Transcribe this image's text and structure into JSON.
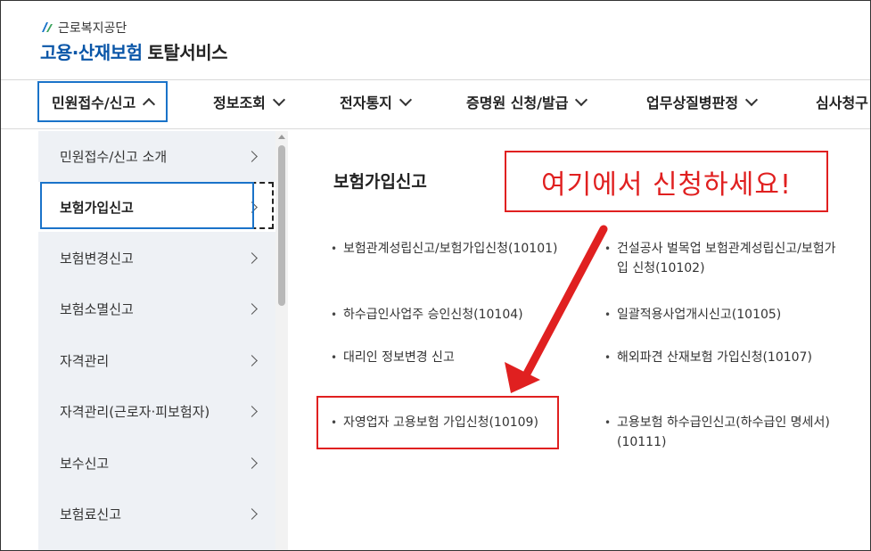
{
  "header": {
    "org_name": "근로복지공단",
    "service_brand": "고용·산재보험",
    "service_tail": "토탈서비스"
  },
  "nav": {
    "items": [
      {
        "label": "민원접수/신고",
        "expanded": true
      },
      {
        "label": "정보조회"
      },
      {
        "label": "전자통지"
      },
      {
        "label": "증명원 신청/발급"
      },
      {
        "label": "업무상질병판정"
      },
      {
        "label": "심사청구"
      }
    ]
  },
  "sidebar": {
    "items": [
      {
        "label": "민원접수/신고 소개"
      },
      {
        "label": "보험가입신고",
        "selected": true
      },
      {
        "label": "보험변경신고"
      },
      {
        "label": "보험소멸신고"
      },
      {
        "label": "자격관리"
      },
      {
        "label": "자격관리(근로자·피보험자)"
      },
      {
        "label": "보수신고"
      },
      {
        "label": "보험료신고"
      }
    ]
  },
  "main": {
    "title": "보험가입신고",
    "links": [
      {
        "line1": "보험관계성립신고/보험가입신청(10101)",
        "line2": ""
      },
      {
        "line1": "건설공사 벌목업 보험관계성립신고/보험가",
        "line2": "입 신청(10102)"
      },
      {
        "line1": "하수급인사업주 승인신청(10104)",
        "line2": ""
      },
      {
        "line1": "일괄적용사업개시신고(10105)",
        "line2": ""
      },
      {
        "line1": "대리인 정보변경 신고",
        "line2": ""
      },
      {
        "line1": "해외파견 산재보험 가입신청(10107)",
        "line2": ""
      },
      {
        "line1": "자영업자 고용보험 가입신청(10109)",
        "line2": ""
      },
      {
        "line1": "고용보험 하수급인신고(하수급인 명세서)",
        "line2": "(10111)"
      }
    ]
  },
  "annotation": {
    "callout_text": "여기에서 신청하세요!",
    "color": "#e02020"
  },
  "colors": {
    "brand": "#0a56a8",
    "focus": "#1a73c9",
    "sidebar_bg": "#eef1f5"
  }
}
